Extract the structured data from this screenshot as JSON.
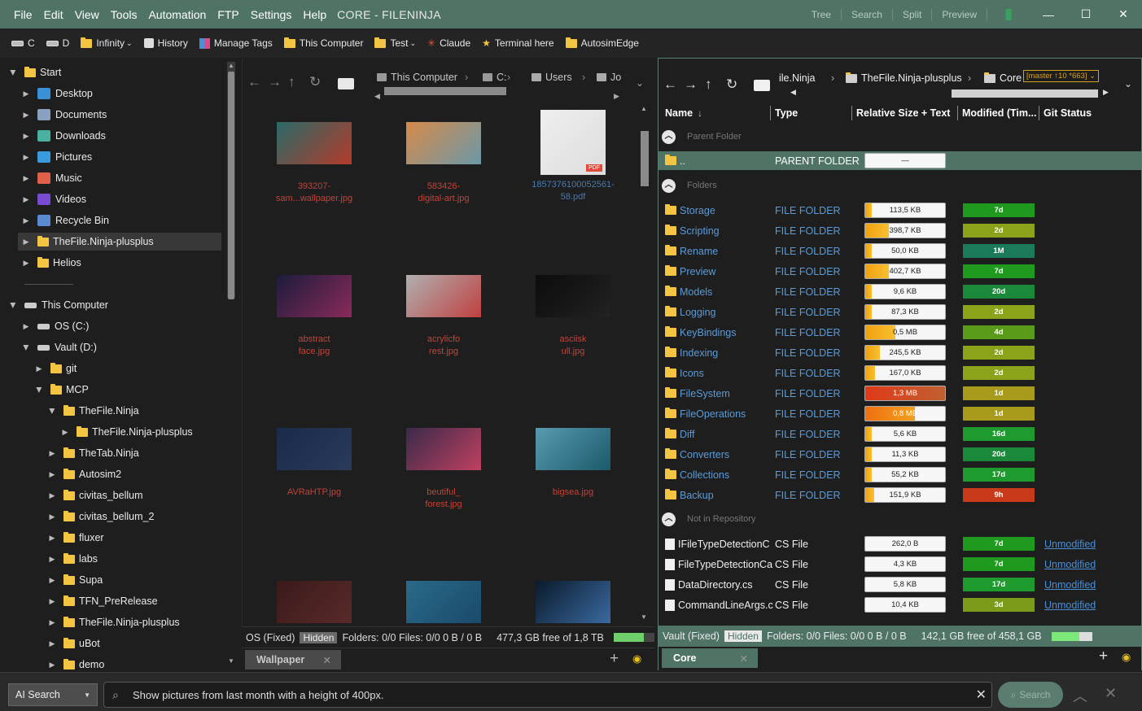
{
  "menu": {
    "items": [
      "File",
      "Edit",
      "View",
      "Tools",
      "Automation",
      "FTP",
      "Settings",
      "Help"
    ],
    "title": "CORE - FILENINJA"
  },
  "titlebar_links": [
    "Tree",
    "Search",
    "Split",
    "Preview"
  ],
  "toolbar": {
    "items": [
      {
        "label": "C",
        "icon": "drive-icon"
      },
      {
        "label": "D",
        "icon": "drive-icon"
      },
      {
        "label": "Infinity",
        "icon": "folder-icon",
        "dropdown": true
      },
      {
        "label": "History",
        "icon": "history-icon"
      },
      {
        "label": "Manage Tags",
        "icon": "tags-icon"
      },
      {
        "label": "This Computer",
        "icon": "folder-icon"
      },
      {
        "label": "Test",
        "icon": "folder-icon",
        "dropdown": true
      },
      {
        "label": "Claude",
        "icon": "claude-icon"
      },
      {
        "label": "Terminal here",
        "icon": "star-icon"
      },
      {
        "label": "AutosimEdge",
        "icon": "folder-icon"
      }
    ]
  },
  "tree": {
    "quick": [
      {
        "label": "Start",
        "level": 0,
        "expanded": true,
        "icon": "start-folder-icon"
      },
      {
        "label": "Desktop",
        "level": 1,
        "icon": "desktop-icon"
      },
      {
        "label": "Documents",
        "level": 1,
        "icon": "documents-icon"
      },
      {
        "label": "Downloads",
        "level": 1,
        "icon": "downloads-icon"
      },
      {
        "label": "Pictures",
        "level": 1,
        "icon": "pictures-icon"
      },
      {
        "label": "Music",
        "level": 1,
        "icon": "music-icon"
      },
      {
        "label": "Videos",
        "level": 1,
        "icon": "videos-icon"
      },
      {
        "label": "Recycle Bin",
        "level": 1,
        "icon": "recycle-bin-icon"
      },
      {
        "label": "TheFile.Ninja-plusplus",
        "level": 1,
        "icon": "folder-icon",
        "selected": true
      },
      {
        "label": "Helios",
        "level": 1,
        "icon": "folder-icon"
      }
    ],
    "computer": [
      {
        "label": "This Computer",
        "level": 0,
        "expanded": true,
        "icon": "computer-icon"
      },
      {
        "label": "OS (C:)",
        "level": 1,
        "icon": "drive-icon"
      },
      {
        "label": "Vault (D:)",
        "level": 1,
        "expanded": true,
        "icon": "drive-icon"
      },
      {
        "label": "git",
        "level": 2,
        "icon": "folder-icon"
      },
      {
        "label": "MCP",
        "level": 2,
        "expanded": true,
        "icon": "folder-icon"
      },
      {
        "label": "TheFile.Ninja",
        "level": 3,
        "expanded": true,
        "icon": "folder-icon"
      },
      {
        "label": "TheFile.Ninja-plusplus",
        "level": 4,
        "icon": "folder-icon"
      },
      {
        "label": "TheTab.Ninja",
        "level": 3,
        "icon": "folder-icon"
      },
      {
        "label": "Autosim2",
        "level": 3,
        "icon": "folder-icon"
      },
      {
        "label": "civitas_bellum",
        "level": 3,
        "icon": "folder-icon"
      },
      {
        "label": "civitas_bellum_2",
        "level": 3,
        "icon": "folder-icon"
      },
      {
        "label": "fluxer",
        "level": 3,
        "icon": "folder-icon"
      },
      {
        "label": "labs",
        "level": 3,
        "icon": "folder-icon"
      },
      {
        "label": "Supa",
        "level": 3,
        "icon": "folder-icon"
      },
      {
        "label": "TFN_PreRelease",
        "level": 3,
        "icon": "folder-icon"
      },
      {
        "label": "TheFile.Ninja-plusplus",
        "level": 3,
        "icon": "folder-icon"
      },
      {
        "label": "uBot",
        "level": 3,
        "icon": "folder-icon"
      },
      {
        "label": "demo",
        "level": 3,
        "icon": "folder-icon"
      }
    ]
  },
  "mid": {
    "breadcrumbs": [
      "This Computer",
      "C:",
      "Users",
      "Jo"
    ],
    "thumbs": [
      {
        "caption": "393207-\nsam...wallpaper.jpg",
        "colors": [
          "#2a6a68",
          "#b33a2a"
        ]
      },
      {
        "caption": "583426-\ndigital-art.jpg",
        "colors": [
          "#d68a4a",
          "#6b98a8"
        ]
      },
      {
        "caption": "1857376100052561-\n58.pdf",
        "colors": [
          "#eeeeee",
          "#dddddd"
        ],
        "pdf": true
      },
      {
        "caption": "abstract\nface.jpg",
        "colors": [
          "#1c1c3c",
          "#8a2a5a"
        ]
      },
      {
        "caption": "acrylicfo\nrest.jpg",
        "colors": [
          "#b0b0b0",
          "#c04040"
        ]
      },
      {
        "caption": "asciisk\null.jpg",
        "colors": [
          "#0c0c0c",
          "#222222"
        ]
      },
      {
        "caption": "AVRaHTP.jpg",
        "colors": [
          "#1a2a4a",
          "#2a3a5a"
        ]
      },
      {
        "caption": "beutiful_\nforest.jpg",
        "colors": [
          "#3a2a4a",
          "#c04060"
        ]
      },
      {
        "caption": "bigsea.jpg",
        "colors": [
          "#5a9ab0",
          "#1a5a6a"
        ]
      },
      {
        "caption": "",
        "colors": [
          "#3a1a1a",
          "#5a2a2a"
        ]
      },
      {
        "caption": "",
        "colors": [
          "#2a6a8a",
          "#1a4a6a"
        ]
      },
      {
        "caption": "",
        "colors": [
          "#0a1a2a",
          "#3a6aa0"
        ]
      }
    ],
    "status": {
      "drive": "OS (Fixed)",
      "hidden": "Hidden",
      "counts": "Folders: 0/0 Files: 0/0 0 B / 0 B",
      "free": "477,3 GB free of 1,8 TB",
      "used_fraction": 0.74
    },
    "tab": "Wallpaper"
  },
  "right": {
    "breadcrumbs": [
      "ile.Ninja",
      "TheFile.Ninja-plusplus",
      "Core"
    ],
    "branch": "[master ↑10 *663]",
    "columns": [
      "Name",
      "Type",
      "Relative Size + Text",
      "Modified (Tim...",
      "Git Status"
    ],
    "groups": {
      "parent": "Parent Folder",
      "folders": "Folders",
      "notrepo": "Not in Repository"
    },
    "parent_row": {
      "name": "..",
      "type": "PARENT FOLDER",
      "size": "—"
    },
    "folders": [
      {
        "name": "Storage",
        "type": "FILE FOLDER",
        "size": "113,5 KB",
        "frac": 0.08,
        "age": "7d",
        "age_color": "#1f9a1f"
      },
      {
        "name": "Scripting",
        "type": "FILE FOLDER",
        "size": "398,7 KB",
        "frac": 0.3,
        "age": "2d",
        "age_color": "#8aa31a"
      },
      {
        "name": "Rename",
        "type": "FILE FOLDER",
        "size": "50,0 KB",
        "frac": 0.04,
        "age": "1M",
        "age_color": "#1a7a5a"
      },
      {
        "name": "Preview",
        "type": "FILE FOLDER",
        "size": "402,7 KB",
        "frac": 0.3,
        "age": "7d",
        "age_color": "#1f9a1f"
      },
      {
        "name": "Models",
        "type": "FILE FOLDER",
        "size": "9,6 KB",
        "frac": 0.01,
        "age": "20d",
        "age_color": "#1a8a3a"
      },
      {
        "name": "Logging",
        "type": "FILE FOLDER",
        "size": "87,3 KB",
        "frac": 0.07,
        "age": "2d",
        "age_color": "#8aa31a"
      },
      {
        "name": "KeyBindings",
        "type": "FILE FOLDER",
        "size": "0,5 MB",
        "frac": 0.38,
        "age": "4d",
        "age_color": "#5a9a1a"
      },
      {
        "name": "Indexing",
        "type": "FILE FOLDER",
        "size": "245,5 KB",
        "frac": 0.18,
        "age": "2d",
        "age_color": "#8aa31a"
      },
      {
        "name": "Icons",
        "type": "FILE FOLDER",
        "size": "167,0 KB",
        "frac": 0.12,
        "age": "2d",
        "age_color": "#8aa31a"
      },
      {
        "name": "FileSystem",
        "type": "FILE FOLDER",
        "size": "1,3 MB",
        "frac": 1.0,
        "age": "1d",
        "age_color": "#a89a1a"
      },
      {
        "name": "FileOperations",
        "type": "FILE FOLDER",
        "size": "0,8 MB",
        "frac": 0.62,
        "age": "1d",
        "age_color": "#a89a1a"
      },
      {
        "name": "Diff",
        "type": "FILE FOLDER",
        "size": "5,6 KB",
        "frac": 0.01,
        "age": "16d",
        "age_color": "#1f9a2f"
      },
      {
        "name": "Converters",
        "type": "FILE FOLDER",
        "size": "11,3 KB",
        "frac": 0.01,
        "age": "20d",
        "age_color": "#1a8a3a"
      },
      {
        "name": "Collections",
        "type": "FILE FOLDER",
        "size": "55,2 KB",
        "frac": 0.04,
        "age": "17d",
        "age_color": "#1f9a2f"
      },
      {
        "name": "Backup",
        "type": "FILE FOLDER",
        "size": "151,9 KB",
        "frac": 0.11,
        "age": "9h",
        "age_color": "#c83a1a"
      }
    ],
    "files": [
      {
        "name": "IFileTypeDetectionC",
        "type": "CS File",
        "size": "262,0 B",
        "age": "7d",
        "age_color": "#1f9a1f",
        "git": "Unmodified"
      },
      {
        "name": "FileTypeDetectionCa",
        "type": "CS File",
        "size": "4,3 KB",
        "age": "7d",
        "age_color": "#1f9a1f",
        "git": "Unmodified"
      },
      {
        "name": "DataDirectory.cs",
        "type": "CS File",
        "size": "5,8 KB",
        "age": "17d",
        "age_color": "#1f9a2f",
        "git": "Unmodified"
      },
      {
        "name": "CommandLineArgs.c",
        "type": "CS File",
        "size": "10,4 KB",
        "age": "3d",
        "age_color": "#7a9a1a",
        "git": "Unmodified"
      }
    ],
    "status": {
      "drive": "Vault (Fixed)",
      "hidden": "Hidden",
      "counts": "Folders: 0/0 Files: 0/0 0 B / 0 B",
      "free": "142,1 GB free of 458,1 GB",
      "used_fraction": 0.69
    },
    "tab": "Core"
  },
  "ai": {
    "mode": "AI Search",
    "query": "Show pictures from last month with a height of 400px.",
    "button": "Search"
  }
}
